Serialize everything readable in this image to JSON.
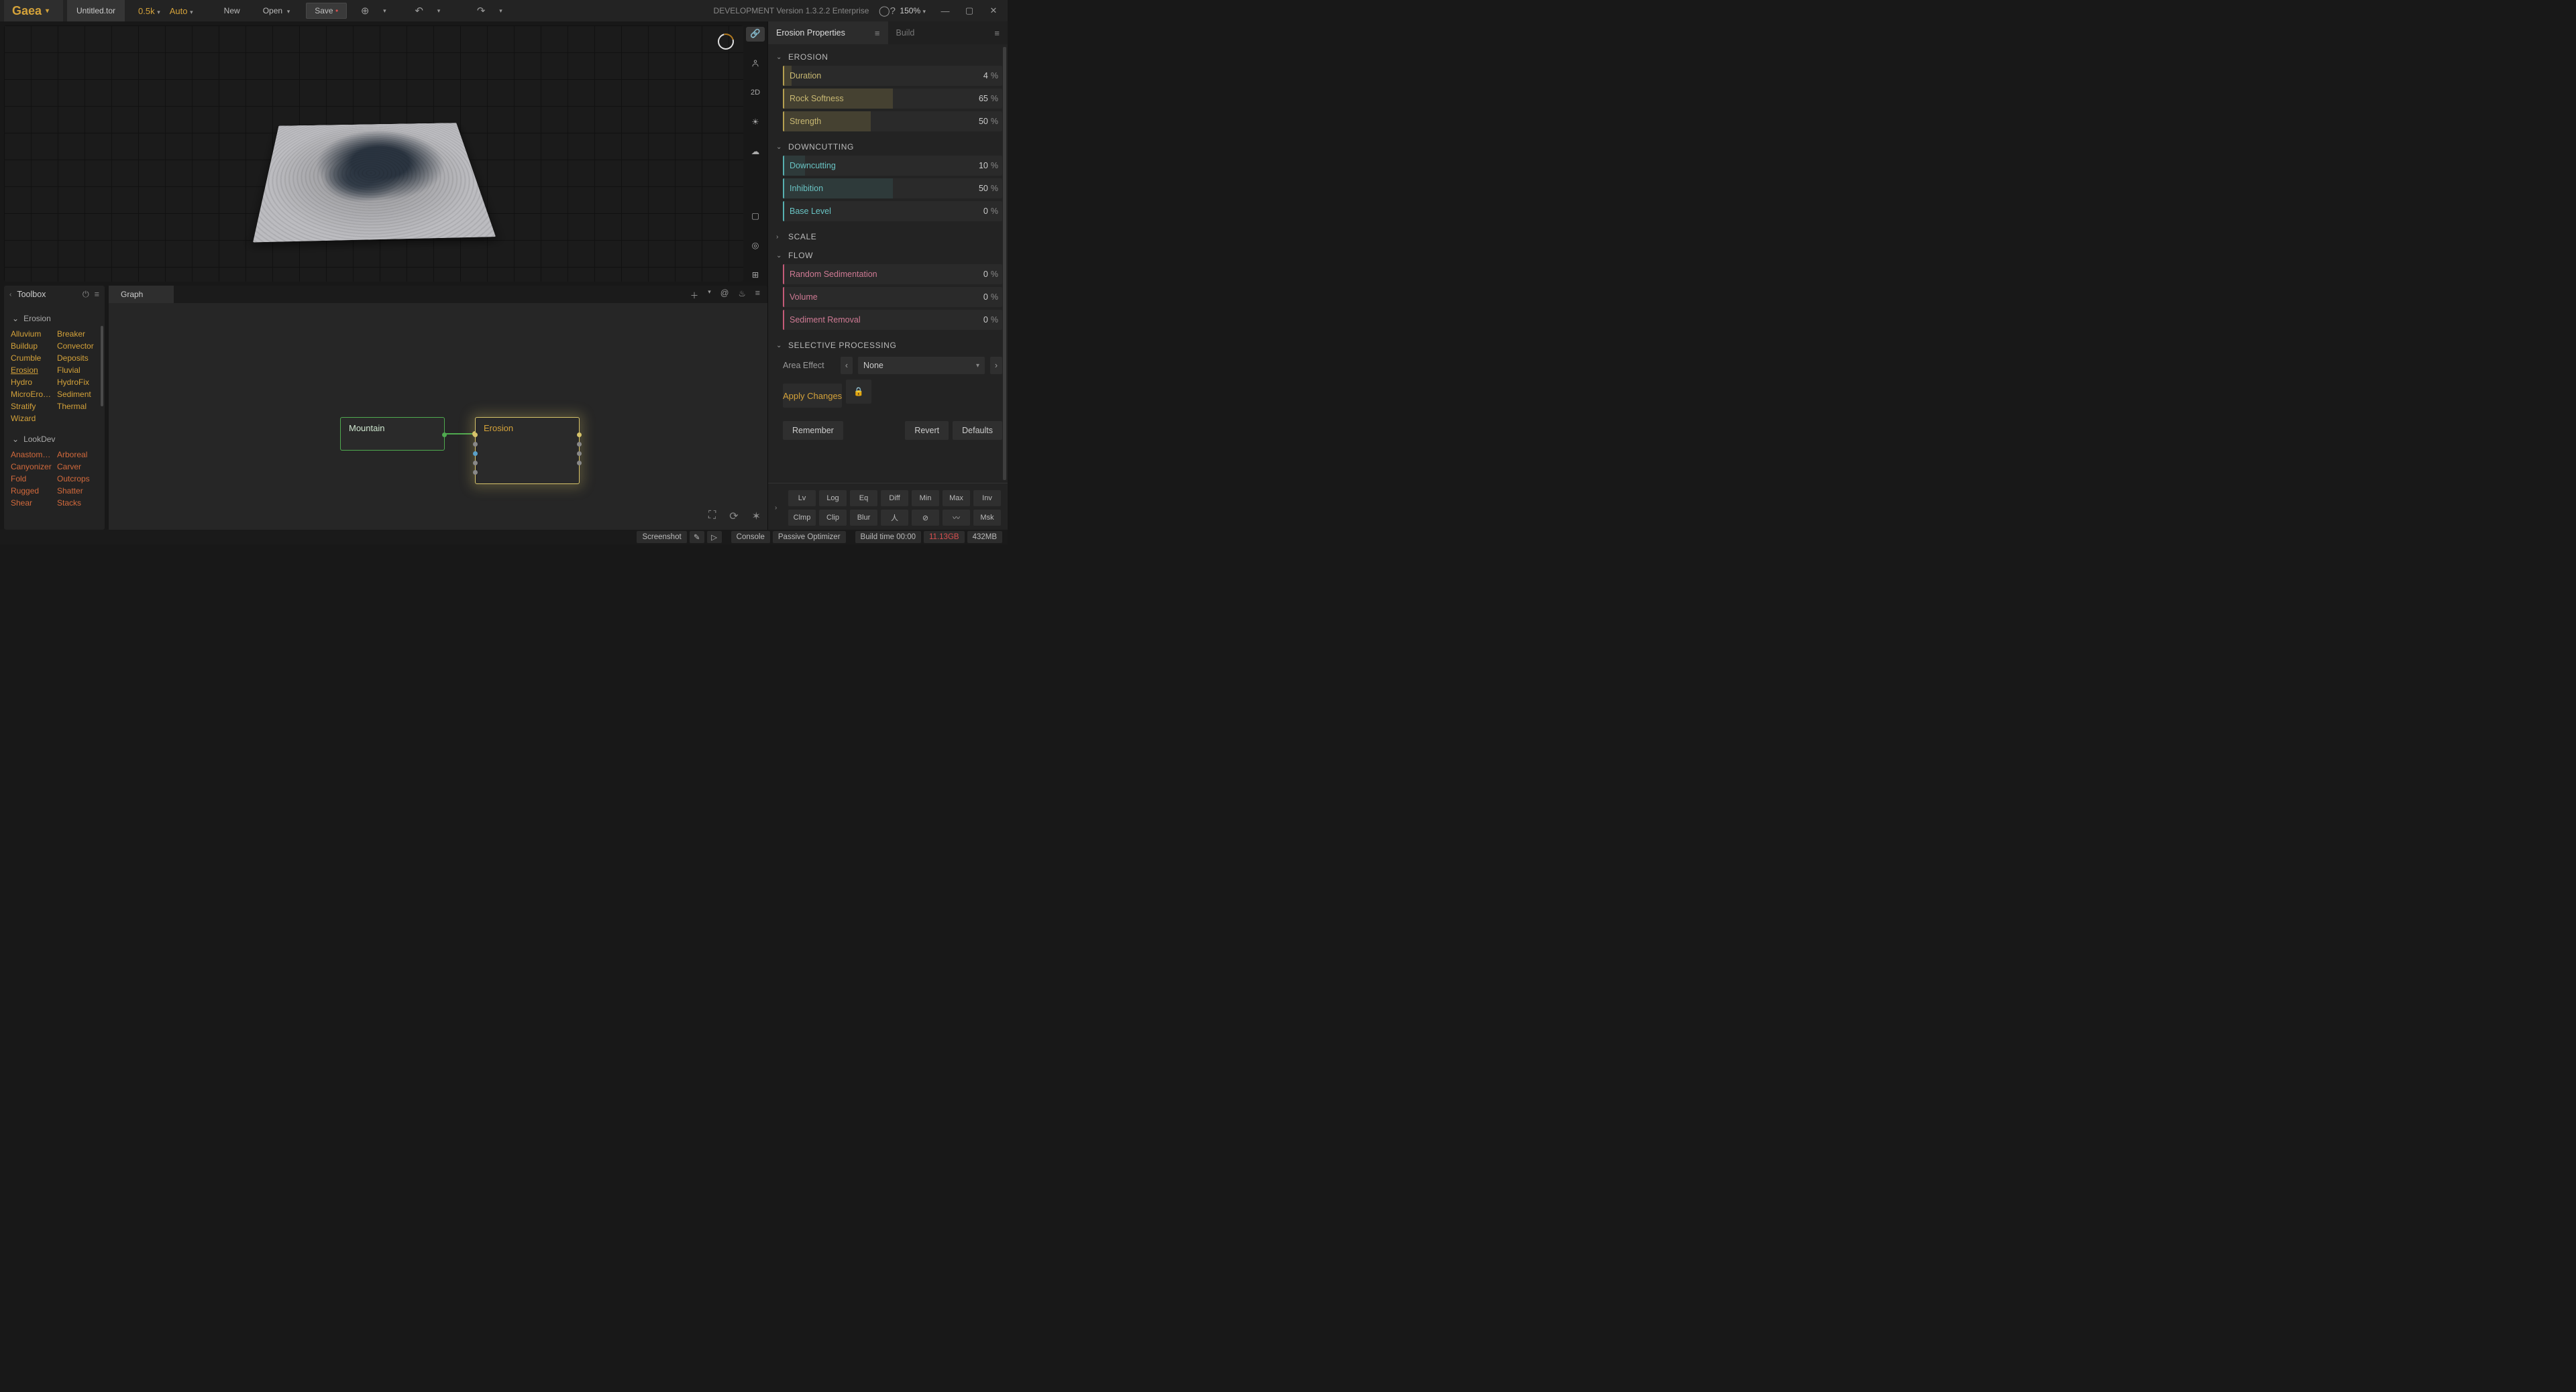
{
  "app": {
    "brand": "Gaea",
    "filename": "Untitled.tor",
    "resolution": "0.5k",
    "auto": "Auto"
  },
  "toolbar": {
    "new": "New",
    "open": "Open",
    "save": "Save",
    "dev_label": "DEVELOPMENT Version 1.3.2.2 Enterprise",
    "zoom": "150%"
  },
  "viewside": {
    "mode2d": "2D"
  },
  "toolbox": {
    "title": "Toolbox",
    "groups": [
      {
        "name": "Erosion",
        "items": [
          "Alluvium",
          "Breaker",
          "Buildup",
          "Convector",
          "Crumble",
          "Deposits",
          "Erosion",
          "Fluvial",
          "Hydro",
          "HydroFix",
          "MicroEros…",
          "Sediment",
          "Stratify",
          "Thermal",
          "Wizard",
          ""
        ]
      },
      {
        "name": "LookDev",
        "items": [
          "Anastom…",
          "Arboreal",
          "Canyonizer",
          "Carver",
          "Fold",
          "Outcrops",
          "Rugged",
          "Shatter",
          "Shear",
          "Stacks"
        ]
      }
    ]
  },
  "graph": {
    "tab": "Graph",
    "nodes": {
      "mountain": "Mountain",
      "erosion": "Erosion"
    }
  },
  "props": {
    "tabs": {
      "properties": "Erosion Properties",
      "build": "Build"
    },
    "sections": {
      "erosion": {
        "title": "EROSION",
        "params": [
          {
            "label": "Duration",
            "value": "4",
            "unit": "%",
            "pct": 4
          },
          {
            "label": "Rock Softness",
            "value": "65",
            "unit": "%",
            "pct": 50
          },
          {
            "label": "Strength",
            "value": "50",
            "unit": "%",
            "pct": 40
          }
        ]
      },
      "downcutting": {
        "title": "DOWNCUTTING",
        "params": [
          {
            "label": "Downcutting",
            "value": "10",
            "unit": "%",
            "pct": 10
          },
          {
            "label": "Inhibition",
            "value": "50",
            "unit": "%",
            "pct": 50
          },
          {
            "label": "Base Level",
            "value": "0",
            "unit": "%",
            "pct": 0
          }
        ]
      },
      "scale": {
        "title": "SCALE"
      },
      "flow": {
        "title": "FLOW",
        "params": [
          {
            "label": "Random Sedimentation",
            "value": "0",
            "unit": "%",
            "pct": 0
          },
          {
            "label": "Volume",
            "value": "0",
            "unit": "%",
            "pct": 0
          },
          {
            "label": "Sediment Removal",
            "value": "0",
            "unit": "%",
            "pct": 0
          }
        ]
      },
      "selective": {
        "title": "SELECTIVE PROCESSING",
        "area_label": "Area Effect",
        "area_value": "None"
      }
    },
    "apply": "Apply Changes",
    "footer": {
      "remember": "Remember",
      "revert": "Revert",
      "defaults": "Defaults"
    },
    "ops": [
      "Lv",
      "Log",
      "Eq",
      "Diff",
      "Min",
      "Max",
      "Inv",
      "Clmp",
      "Clip",
      "Blur",
      "人",
      "⊘",
      "〰",
      "Msk"
    ]
  },
  "status": {
    "screenshot": "Screenshot",
    "console": "Console",
    "passive": "Passive Optimizer",
    "buildtime": "Build time 00:00",
    "mem1": "11.13GB",
    "mem2": "432MB"
  }
}
